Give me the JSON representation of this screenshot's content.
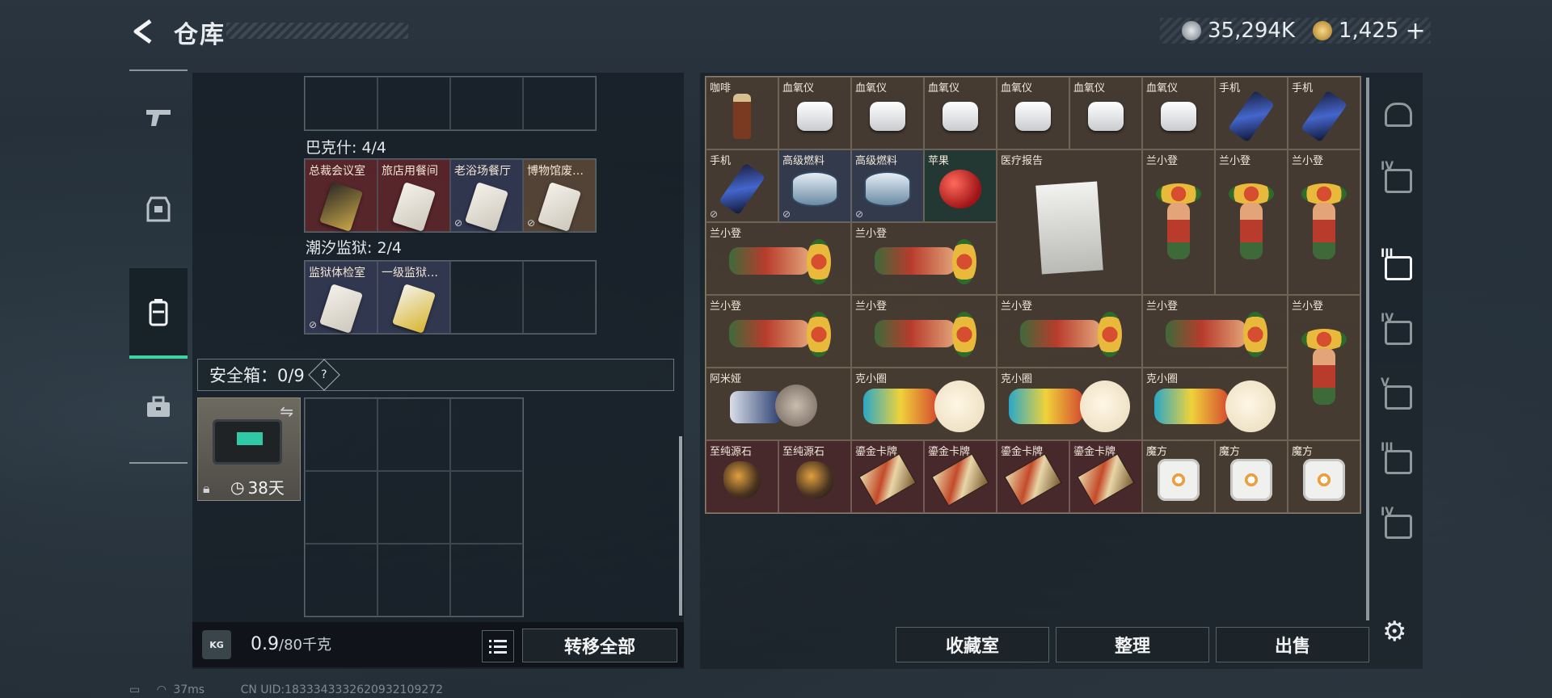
{
  "header": {
    "title": "仓库",
    "currency1": "35,294K",
    "currency2": "1,425",
    "currency2_plus": "+",
    "colors": {
      "accent": "#3dd6a0",
      "coin1": "#9aa3aa",
      "coin2": "#d8a83a"
    }
  },
  "left_nav": [
    {
      "icon": "gun-icon"
    },
    {
      "icon": "armor-icon"
    },
    {
      "icon": "backpack-icon"
    },
    {
      "icon": "briefcase-icon"
    }
  ],
  "bakeshi": {
    "label": "巴克什: 4/4",
    "cards": [
      "总裁会议室",
      "旅店用餐间",
      "老浴场餐厅",
      "博物馆废…"
    ]
  },
  "chaoxi": {
    "label": "潮汐监狱: 2/4",
    "cards": [
      "监狱体检室",
      "一级监狱…"
    ]
  },
  "safe": {
    "label": "安全箱：0/9",
    "help": "?",
    "case_time": "38天"
  },
  "weight": {
    "value": "0.9",
    "unit": "/80千克",
    "kg_icon": "KG",
    "transfer_all": "转移全部"
  },
  "items": [
    {
      "name": "咖啡",
      "kind": "bottle",
      "rarity": "gold"
    },
    {
      "name": "血氧仪",
      "kind": "oxi",
      "rarity": "gold"
    },
    {
      "name": "血氧仪",
      "kind": "oxi",
      "rarity": "gold"
    },
    {
      "name": "血氧仪",
      "kind": "oxi",
      "rarity": "gold"
    },
    {
      "name": "血氧仪",
      "kind": "oxi",
      "rarity": "gold"
    },
    {
      "name": "血氧仪",
      "kind": "oxi",
      "rarity": "gold"
    },
    {
      "name": "血氧仪",
      "kind": "oxi",
      "rarity": "gold"
    },
    {
      "name": "手机",
      "kind": "phone",
      "rarity": "gold"
    },
    {
      "name": "手机",
      "kind": "phone",
      "rarity": "gold"
    },
    {
      "name": "手机",
      "kind": "phone",
      "rarity": "gold"
    },
    {
      "name": "高级燃料",
      "kind": "can",
      "rarity": "blue"
    },
    {
      "name": "高级燃料",
      "kind": "can",
      "rarity": "blue"
    },
    {
      "name": "苹果",
      "kind": "apple",
      "rarity": "green"
    },
    {
      "name": "医疗报告",
      "kind": "report",
      "rarity": "gold"
    },
    {
      "name": "兰小登",
      "kind": "figure",
      "rarity": "gold"
    },
    {
      "name": "兰小登",
      "kind": "figure",
      "rarity": "gold"
    },
    {
      "name": "兰小登",
      "kind": "figure",
      "rarity": "gold"
    },
    {
      "name": "兰小登",
      "kind": "fig-lie",
      "rarity": "gold"
    },
    {
      "name": "兰小登",
      "kind": "fig-lie",
      "rarity": "gold"
    },
    {
      "name": "兰小登",
      "kind": "fig-lie",
      "rarity": "gold"
    },
    {
      "name": "兰小登",
      "kind": "fig-lie",
      "rarity": "gold"
    },
    {
      "name": "兰小登",
      "kind": "fig-lie",
      "rarity": "gold"
    },
    {
      "name": "兰小登",
      "kind": "fig-lie",
      "rarity": "gold"
    },
    {
      "name": "兰小登",
      "kind": "figure",
      "rarity": "gold"
    },
    {
      "name": "阿米娅",
      "kind": "doll",
      "rarity": "gold"
    },
    {
      "name": "克小圈",
      "kind": "kx",
      "rarity": "gold"
    },
    {
      "name": "克小圈",
      "kind": "kx",
      "rarity": "gold"
    },
    {
      "name": "克小圈",
      "kind": "kx",
      "rarity": "gold"
    },
    {
      "name": "至纯源石",
      "kind": "stone",
      "rarity": "red"
    },
    {
      "name": "至纯源石",
      "kind": "stone",
      "rarity": "red"
    },
    {
      "name": "鎏金卡牌",
      "kind": "cardg",
      "rarity": "red"
    },
    {
      "name": "鎏金卡牌",
      "kind": "cardg",
      "rarity": "red"
    },
    {
      "name": "鎏金卡牌",
      "kind": "cardg",
      "rarity": "red"
    },
    {
      "name": "鎏金卡牌",
      "kind": "cardg",
      "rarity": "red"
    },
    {
      "name": "魔方",
      "kind": "cube",
      "rarity": "gold"
    },
    {
      "name": "魔方",
      "kind": "cube",
      "rarity": "gold"
    },
    {
      "name": "魔方",
      "kind": "cube",
      "rarity": "gold"
    }
  ],
  "bottom_buttons": {
    "collection": "收藏室",
    "sort": "整理",
    "sell": "出售"
  },
  "right_nav": [
    {
      "icon": "base-icon",
      "tier": ""
    },
    {
      "icon": "backpack-tier-icon",
      "tier": "IV"
    },
    {
      "icon": "rig-tier-icon",
      "tier": "III"
    },
    {
      "icon": "armor-tier-icon",
      "tier": "IV"
    },
    {
      "icon": "armor-tier-icon",
      "tier": "V"
    },
    {
      "icon": "rig-tier-icon",
      "tier": "III"
    },
    {
      "icon": "backpack-tier-icon",
      "tier": "IV"
    }
  ],
  "status": {
    "ping": "37ms",
    "uid": "CN UID:1833343332620932109272"
  }
}
